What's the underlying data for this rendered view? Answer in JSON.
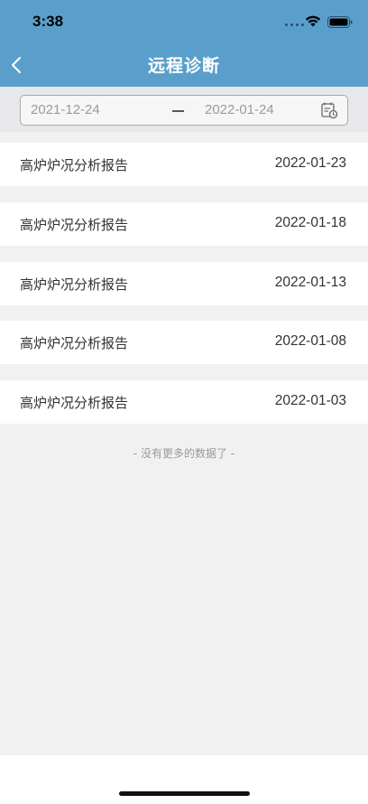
{
  "status_bar": {
    "time": "3:38"
  },
  "nav": {
    "title": "远程诊断"
  },
  "date_range": {
    "start": "2021-12-24",
    "end": "2022-01-24"
  },
  "reports": [
    {
      "title": "高炉炉况分析报告",
      "date": "2022-01-23"
    },
    {
      "title": "高炉炉况分析报告",
      "date": "2022-01-18"
    },
    {
      "title": "高炉炉况分析报告",
      "date": "2022-01-13"
    },
    {
      "title": "高炉炉况分析报告",
      "date": "2022-01-08"
    },
    {
      "title": "高炉炉况分析报告",
      "date": "2022-01-03"
    }
  ],
  "footer": {
    "no_more_text": "- 没有更多的数据了 -"
  },
  "colors": {
    "header": "#5a9fcb",
    "background": "#f1f1f2"
  }
}
